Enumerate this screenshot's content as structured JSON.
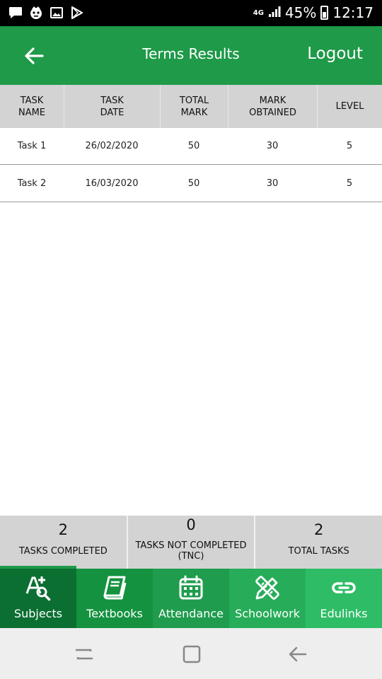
{
  "status_bar": {
    "network": "4G",
    "battery": "45%",
    "time": "12:17"
  },
  "app_bar": {
    "title": "Terms Results",
    "logout_label": "Logout"
  },
  "table": {
    "headers": [
      [
        "TASK",
        "NAME"
      ],
      [
        "TASK",
        "DATE"
      ],
      [
        "TOTAL",
        "MARK"
      ],
      [
        "MARK",
        "OBTAINED"
      ],
      [
        "LEVEL"
      ]
    ],
    "rows": [
      [
        "Task 1",
        "26/02/2020",
        "50",
        "30",
        "5"
      ],
      [
        "Task 2",
        "16/03/2020",
        "50",
        "30",
        "5"
      ]
    ]
  },
  "summary": [
    {
      "value": "2",
      "label": "TASKS COMPLETED"
    },
    {
      "value": "0",
      "label": "TASKS NOT COMPLETED (TNC)"
    },
    {
      "value": "2",
      "label": "TOTAL TASKS"
    }
  ],
  "bottom_nav": [
    {
      "label": "Subjects",
      "icon": "subjects-icon",
      "color": "#0c6f32",
      "active": true
    },
    {
      "label": "Textbooks",
      "icon": "book-icon",
      "color": "#14923f"
    },
    {
      "label": "Attendance",
      "icon": "calendar-icon",
      "color": "#1f9c4d"
    },
    {
      "label": "Schoolwork",
      "icon": "pencil-ruler-icon",
      "color": "#27ad59"
    },
    {
      "label": "Edulinks",
      "icon": "link-icon",
      "color": "#2fbc66"
    }
  ],
  "colors": {
    "primary": "#1e9a48",
    "header_gray": "#d3d3d3"
  }
}
